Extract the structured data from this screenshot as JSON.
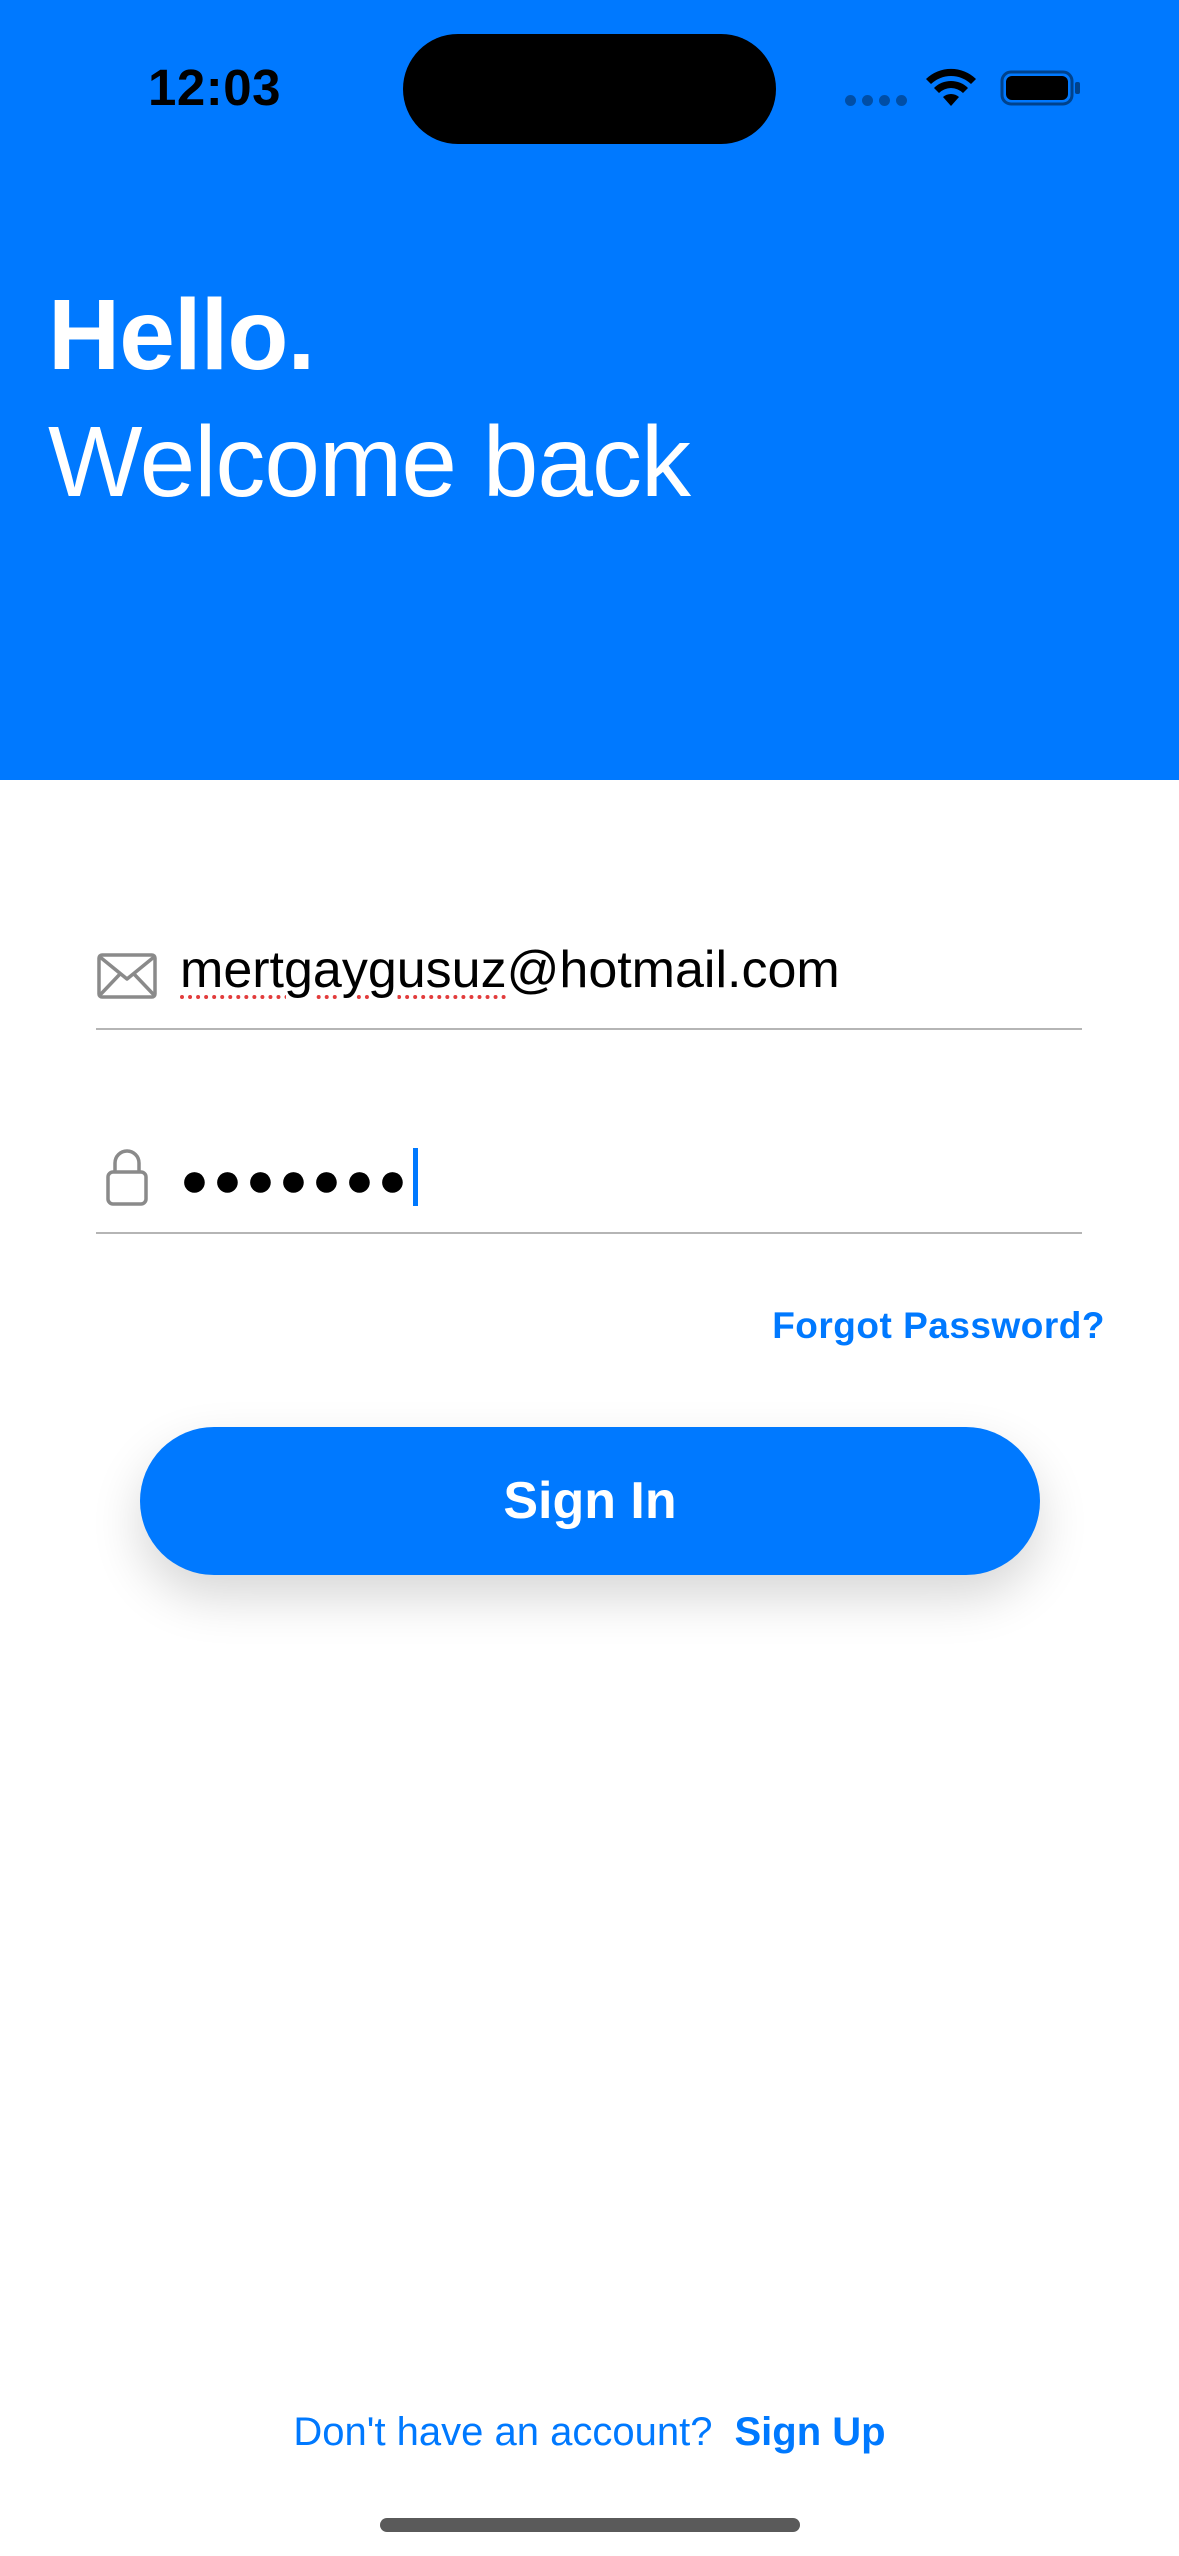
{
  "status_bar": {
    "time": "12:03"
  },
  "header": {
    "greeting": "Hello.",
    "subtitle": "Welcome back",
    "background_color": "#0079FF"
  },
  "form": {
    "email": {
      "icon": "envelope-icon",
      "value_misspelled_part": "mertgaygusuz",
      "value_rest": "@hotmail.com"
    },
    "password": {
      "icon": "lock-icon",
      "masked_value": "●●●●●●●"
    },
    "forgot_password_label": "Forgot Password?",
    "sign_in_label": "Sign In"
  },
  "footer": {
    "prompt": "Don't have an account?",
    "sign_up_label": "Sign Up"
  },
  "colors": {
    "accent": "#0079FF",
    "field_icon": "#8a8a8a",
    "divider": "#b5b5b5"
  }
}
